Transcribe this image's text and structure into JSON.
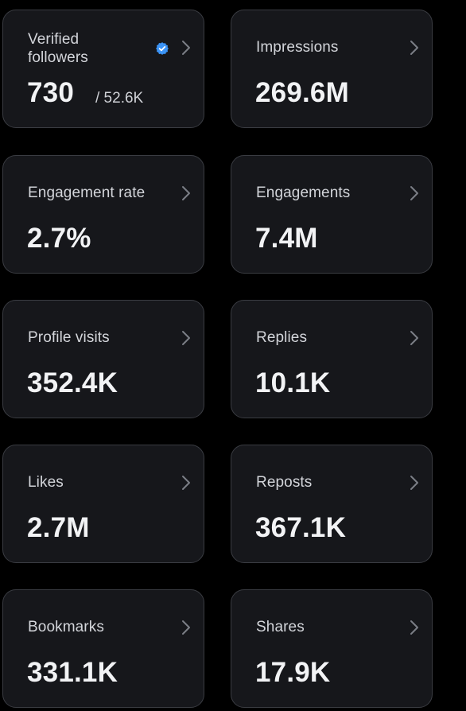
{
  "colors": {
    "background": "#000000",
    "card_background": "#16171b",
    "card_border": "#3a3c42",
    "label_text": "#d3d5da",
    "value_text": "#f2f3f5",
    "chevron": "#7b7e86",
    "verified_badge": "#3b93f5"
  },
  "metrics": [
    {
      "label": "Verified followers",
      "value": "730",
      "sub_value": "/ 52.6K",
      "icon": "verified-badge-icon",
      "chevron_icon": "chevron-right-icon"
    },
    {
      "label": "Impressions",
      "value": "269.6M",
      "chevron_icon": "chevron-right-icon"
    },
    {
      "label": "Engagement rate",
      "value": "2.7%",
      "chevron_icon": "chevron-right-icon"
    },
    {
      "label": "Engagements",
      "value": "7.4M",
      "chevron_icon": "chevron-right-icon"
    },
    {
      "label": "Profile visits",
      "value": "352.4K",
      "chevron_icon": "chevron-right-icon"
    },
    {
      "label": "Replies",
      "value": "10.1K",
      "chevron_icon": "chevron-right-icon"
    },
    {
      "label": "Likes",
      "value": "2.7M",
      "chevron_icon": "chevron-right-icon"
    },
    {
      "label": "Reposts",
      "value": "367.1K",
      "chevron_icon": "chevron-right-icon"
    },
    {
      "label": "Bookmarks",
      "value": "331.1K",
      "chevron_icon": "chevron-right-icon"
    },
    {
      "label": "Shares",
      "value": "17.9K",
      "chevron_icon": "chevron-right-icon"
    }
  ]
}
